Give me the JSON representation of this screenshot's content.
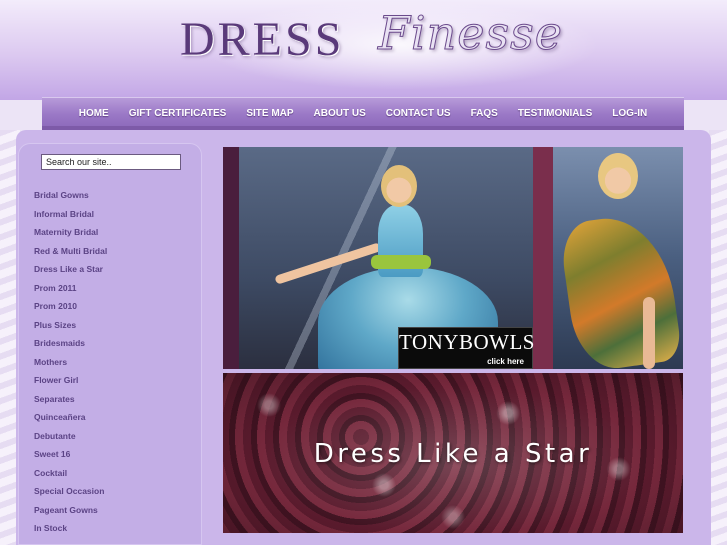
{
  "header": {
    "logo_word1": "DRESS",
    "logo_word2": "Finesse"
  },
  "nav": {
    "items": [
      "HOME",
      "GIFT CERTIFICATES",
      "SITE MAP",
      "ABOUT US",
      "CONTACT US",
      "FAQS",
      "TESTIMONIALS",
      "LOG-IN"
    ]
  },
  "sidebar": {
    "search_value": "Search our site..",
    "items": [
      "Bridal Gowns",
      "Informal Bridal",
      "Maternity Bridal",
      "Red & Multi Bridal",
      "Dress Like a Star",
      "Prom 2011",
      "Prom 2010",
      "Plus Sizes",
      "Bridesmaids",
      "Mothers",
      "Flower Girl",
      "Separates",
      "Quinceañera",
      "Debutante",
      "Sweet 16",
      "Cocktail",
      "Special Occasion",
      "Pageant Gowns",
      "In Stock"
    ]
  },
  "banner1": {
    "brand": "TONYBOWLS",
    "cta": "click here"
  },
  "banner2": {
    "text": "Dress Like a  Star"
  },
  "colors": {
    "nav": "#9a78c6",
    "sidebar": "#c3aee6",
    "menu_text": "#5b4385"
  }
}
